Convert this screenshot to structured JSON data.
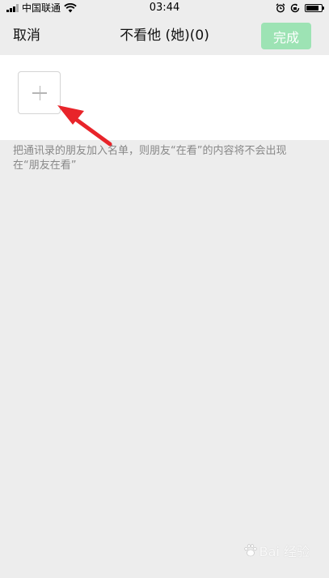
{
  "status_bar": {
    "carrier": "中国联通",
    "time": "03:44"
  },
  "nav": {
    "cancel_label": "取消",
    "title": "不看他 (她)(0)",
    "done_label": "完成"
  },
  "add_button": {
    "icon": "plus-icon"
  },
  "hint_text": "把通讯录的朋友加入名单，则朋友“在看”的内容将不会出现在“朋友在看”",
  "watermark": {
    "text": "Bai 经验"
  },
  "colors": {
    "background": "#ededed",
    "done_button": "#9de3b4",
    "arrow": "#e8242a"
  }
}
